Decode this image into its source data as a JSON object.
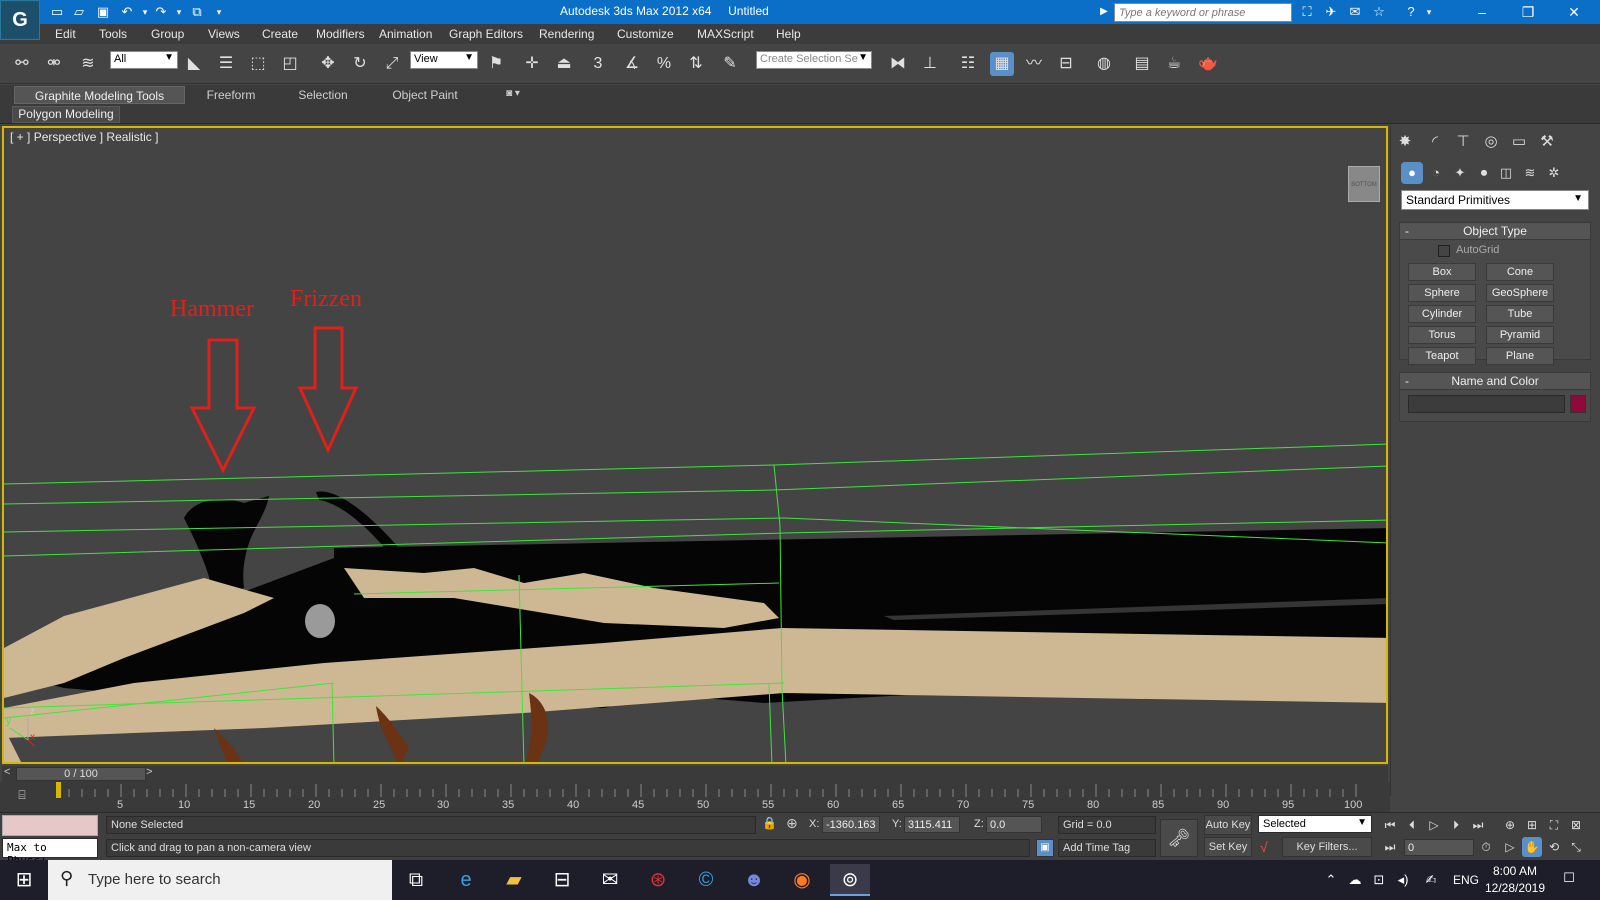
{
  "titlebar": {
    "app_title": "Autodesk 3ds Max  2012 x64",
    "doc_title": "Untitled",
    "search_placeholder": "Type a keyword or phrase",
    "logo_glyph": "G"
  },
  "menu": [
    "Edit",
    "Tools",
    "Group",
    "Views",
    "Create",
    "Modifiers",
    "Animation",
    "Graph Editors",
    "Rendering",
    "Customize",
    "MAXScript",
    "Help"
  ],
  "toolbar": {
    "selection_filter": "All",
    "ref_coord": "View",
    "named_selection_placeholder": "Create Selection Se",
    "snap_label": "3",
    "percent_label": "%"
  },
  "ribbon": {
    "tabs": [
      "Graphite Modeling Tools",
      "Freeform",
      "Selection",
      "Object Paint"
    ],
    "active_panel": "Polygon Modeling"
  },
  "viewport": {
    "label": "[ + ] Perspective ] Realistic ]",
    "label_parts": [
      "[ + ]",
      "Perspective",
      "]",
      "Realistic",
      "]"
    ],
    "viewcube_text": "BOTTOM",
    "annotations": [
      {
        "text": "Hammer"
      },
      {
        "text": "Frizzen"
      }
    ],
    "annotation_color": "#e0201a",
    "selection_color": "#d6b800",
    "wire_color": "#3ce63c"
  },
  "command_panel": {
    "primitive_type": "Standard Primitives",
    "object_type_title": "Object Type",
    "autogrid_label": "AutoGrid",
    "primitives": [
      "Box",
      "Cone",
      "Sphere",
      "GeoSphere",
      "Cylinder",
      "Tube",
      "Torus",
      "Pyramid",
      "Teapot",
      "Plane"
    ],
    "name_color_title": "Name and Color",
    "object_color": "#8f0a3a"
  },
  "timeline": {
    "frame_counter": "0 / 100",
    "prev": "<",
    "next": ">",
    "ticks": [
      "5",
      "10",
      "15",
      "20",
      "25",
      "30",
      "35",
      "40",
      "45",
      "50",
      "55",
      "60",
      "65",
      "70",
      "75",
      "80",
      "85",
      "90",
      "95",
      "100"
    ]
  },
  "status": {
    "listener_text": "Max to Physc:",
    "selection_status": "None Selected",
    "prompt": "Click and drag to pan a non-camera view",
    "x_label": "X:",
    "x_value": "-1360.163",
    "y_label": "Y:",
    "y_value": "3115.411",
    "z_label": "Z:",
    "z_value": "0.0",
    "grid": "Grid = 0.0",
    "add_time_tag": "Add Time Tag",
    "auto_key": "Auto Key",
    "set_key": "Set Key",
    "key_mode": "Selected",
    "key_filters": "Key Filters...",
    "current_frame": "0"
  },
  "taskbar": {
    "search_placeholder": "Type here to search",
    "language": "ENG",
    "time": "8:00 AM",
    "date": "12/28/2019"
  }
}
